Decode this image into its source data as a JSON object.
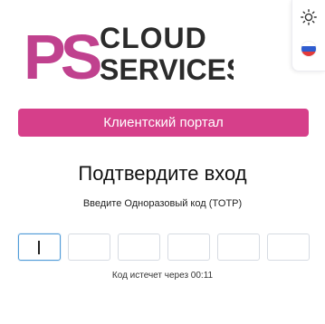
{
  "logo": {
    "monogram": "PS",
    "line1": "CLOUD",
    "line2": "SERVICES",
    "monogram_color": "#c0418e",
    "text_color": "#2b2b2b"
  },
  "theme_toggle": {
    "icon": "sun-icon"
  },
  "language": {
    "icon": "russian-flag-icon",
    "colors": [
      "#ffffff",
      "#2f5ccf",
      "#e23a3a"
    ]
  },
  "portal_button": {
    "label": "Клиентский портал",
    "color": "#d63f8a"
  },
  "heading": {
    "title": "Подтвердите вход"
  },
  "otp": {
    "instruction": "Введите Одноразовый код (TOTP)",
    "digits": [
      "",
      "",
      "",
      "",
      "",
      ""
    ],
    "active_index": 0
  },
  "timer": {
    "text": "Код истечет через 00:11"
  }
}
